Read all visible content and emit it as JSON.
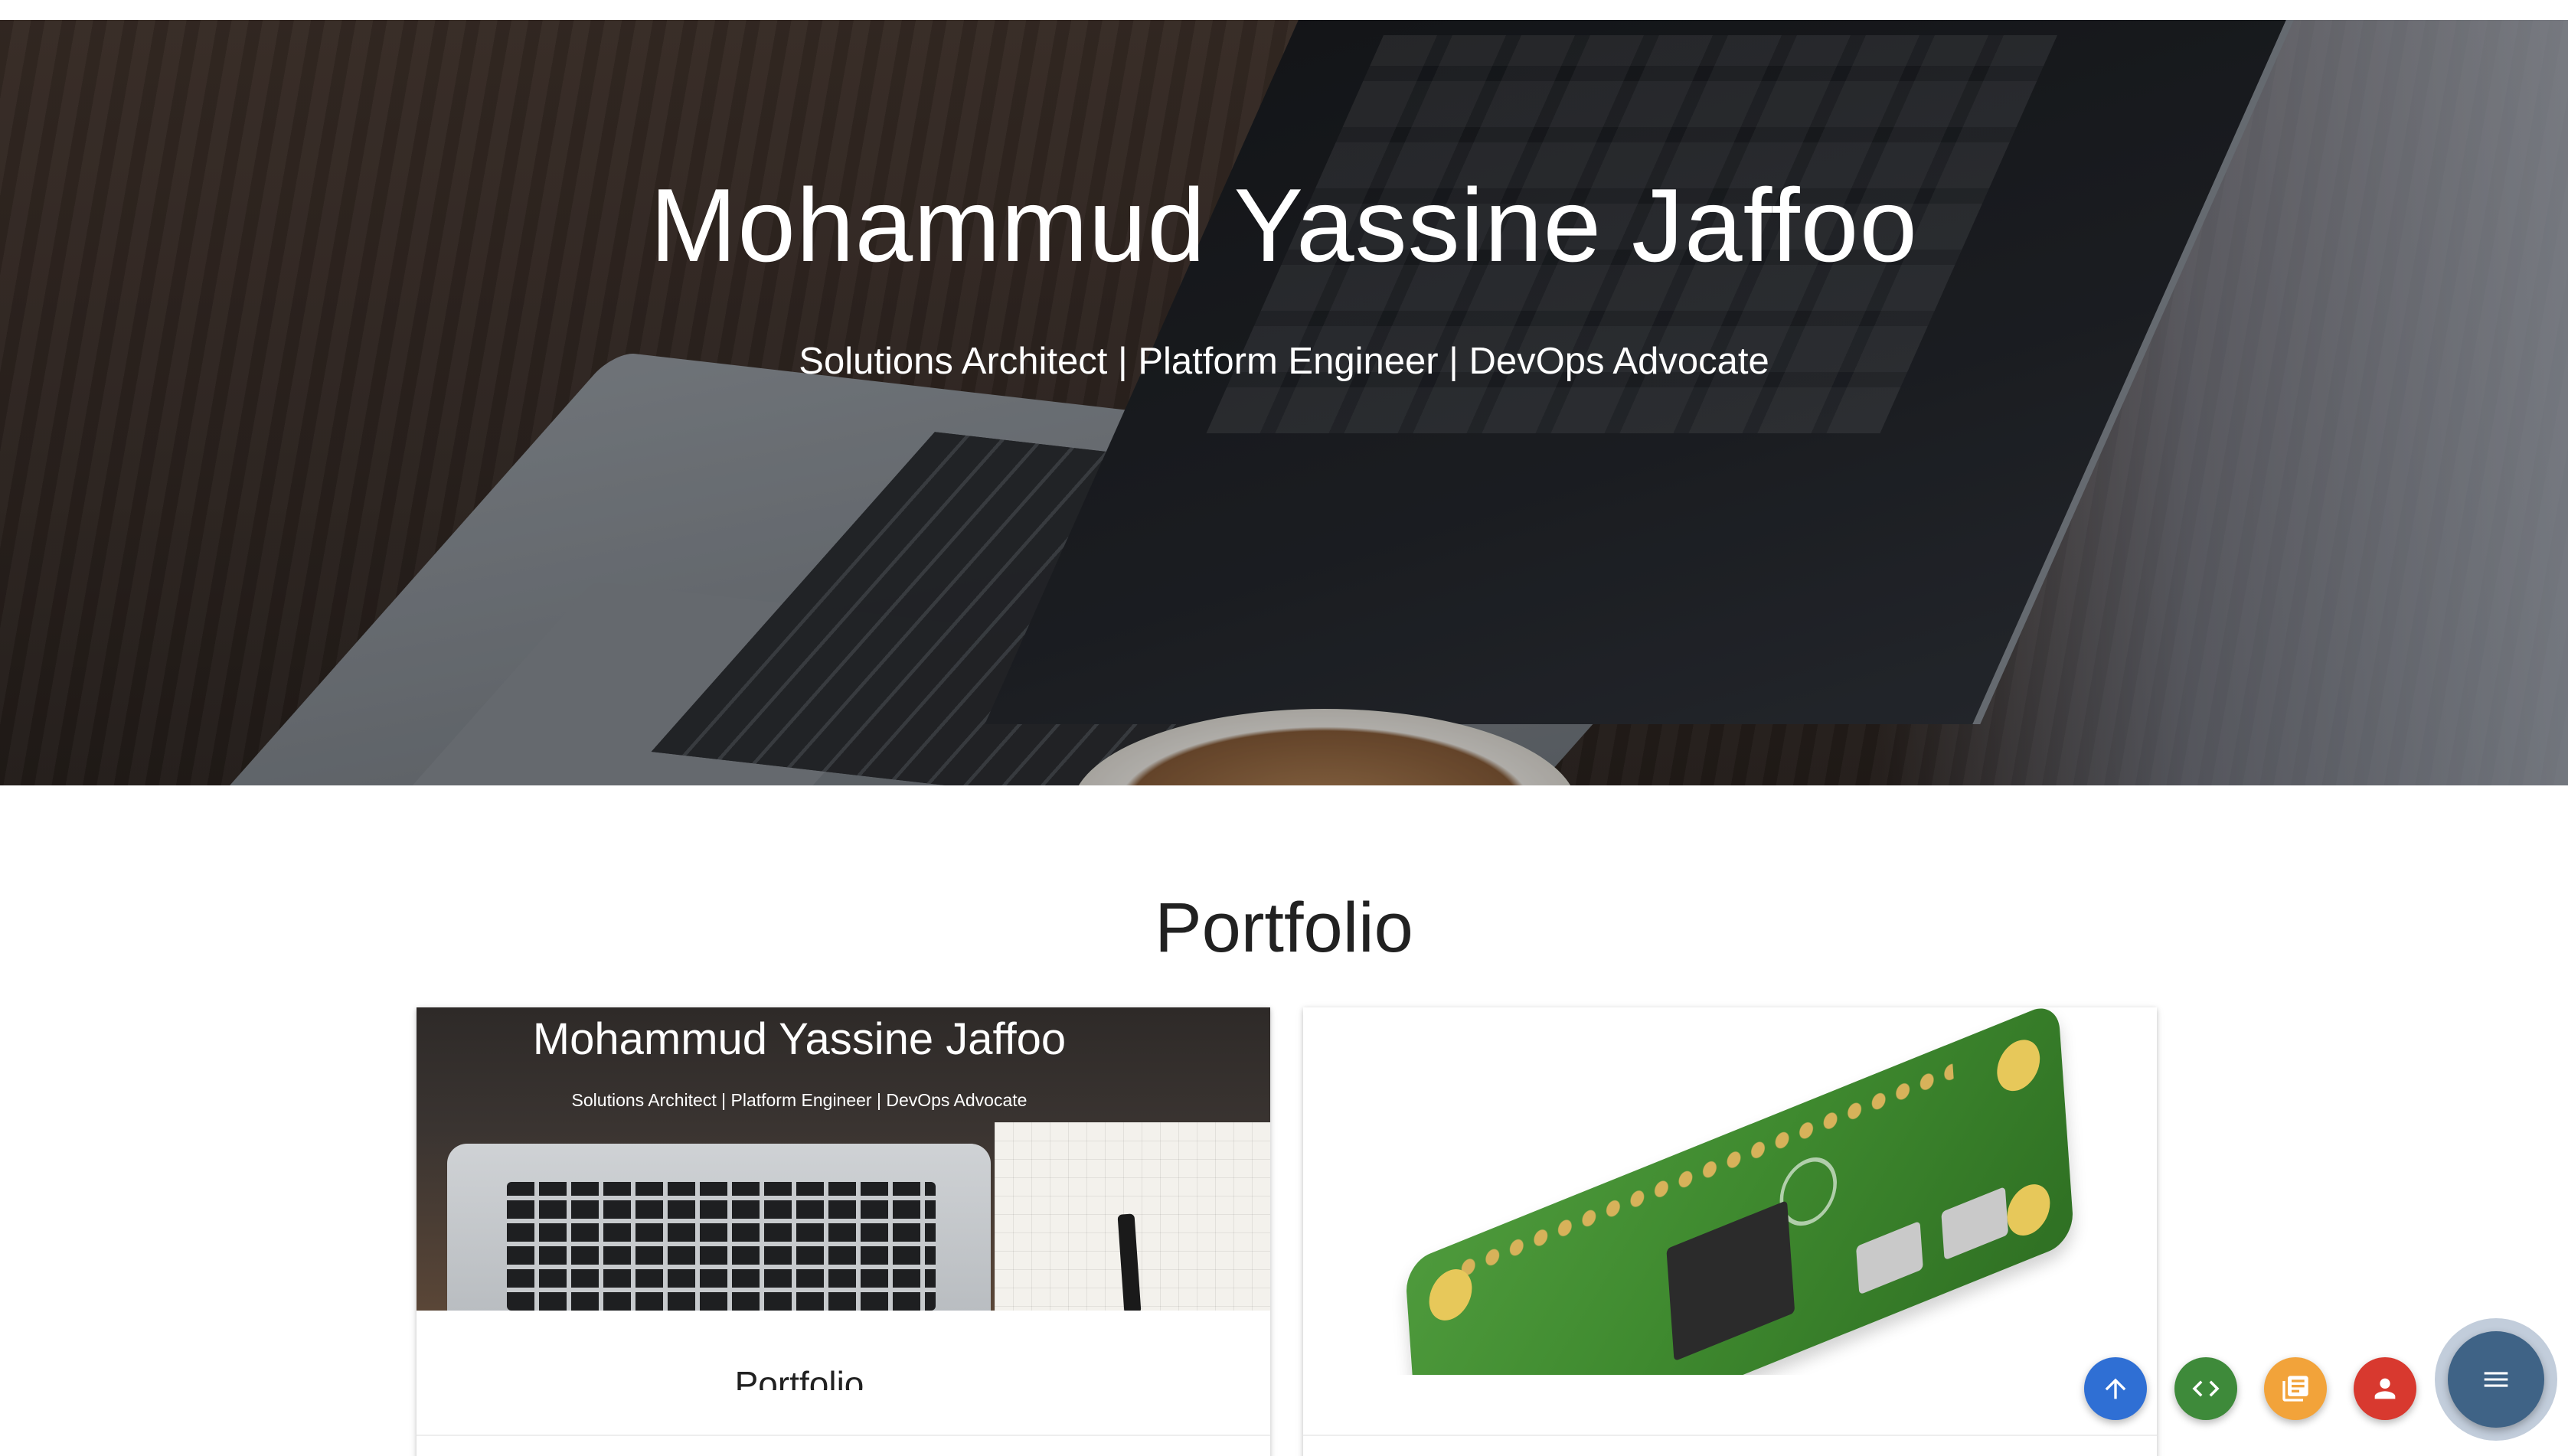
{
  "hero": {
    "title": "Mohammud Yassine Jaffoo",
    "subtitle": "Solutions Architect | Platform Engineer | DevOps Advocate"
  },
  "portfolio": {
    "heading": "Portfolio",
    "cards": [
      {
        "image_headline": "Mohammud Yassine Jaffoo",
        "image_subline": "Solutions Architect | Platform Engineer | DevOps Advocate",
        "title": "Portfolio"
      },
      {
        "image": "raspberry-pi-zero-board"
      }
    ]
  },
  "fab": {
    "buttons": [
      {
        "icon": "arrow-up-icon",
        "color": "#2f6fd4"
      },
      {
        "icon": "code-icon",
        "color": "#3e8a3a"
      },
      {
        "icon": "blog-icon",
        "color": "#f2a33a"
      },
      {
        "icon": "person-icon",
        "color": "#d8392f"
      }
    ],
    "main": {
      "icon": "menu-icon",
      "color": "#3f6386"
    }
  }
}
